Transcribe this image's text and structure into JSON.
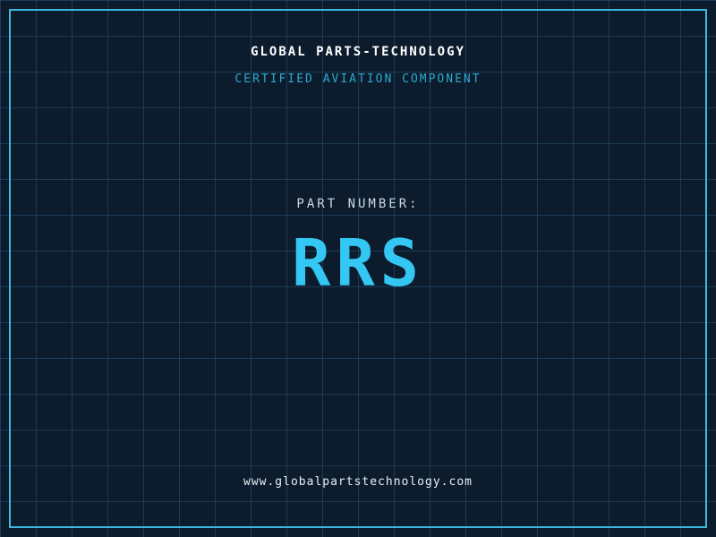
{
  "page": {
    "title": "GLOBAL PARTS-TECHNOLOGY",
    "subtitle": "CERTIFIED AVIATION COMPONENT",
    "part_label": "PART NUMBER:",
    "part_number": "RRS",
    "website": "www.globalpartstechnology.com"
  },
  "colors": {
    "background": "#0c1c2d",
    "grid_line": "#366e98",
    "frame_border": "#3db9dd",
    "title_text": "#ffffff",
    "subtitle_text": "#2ca9cf",
    "part_label_text": "#ccd8e0",
    "part_number_text": "#35c7f3",
    "website_text": "#e8eef3"
  }
}
